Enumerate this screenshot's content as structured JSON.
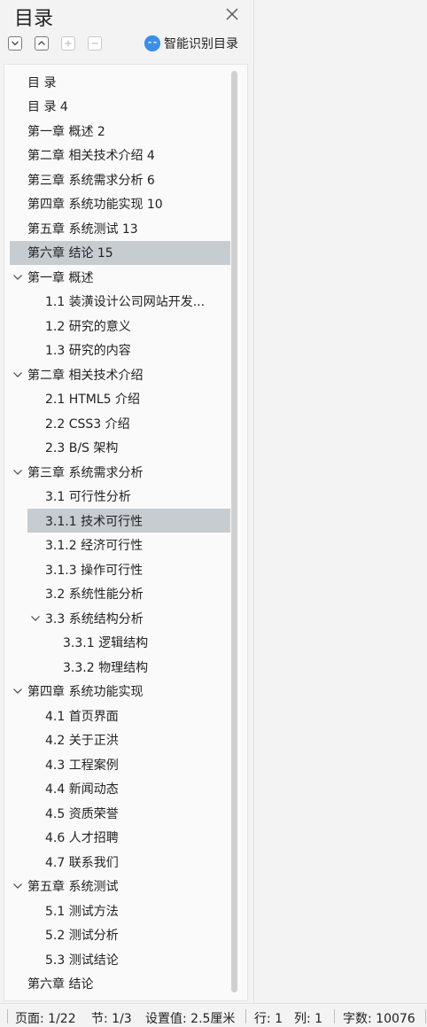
{
  "panel": {
    "title": "目录",
    "smart_label": "智能识别目录"
  },
  "toc": [
    {
      "text": "目  录",
      "level": 0,
      "expanded": null,
      "selected": false
    },
    {
      "text": "目  录 4",
      "level": 0,
      "expanded": null,
      "selected": false
    },
    {
      "text": "第一章   概述  2",
      "level": 0,
      "expanded": null,
      "selected": false
    },
    {
      "text": "第二章   相关技术介绍  4",
      "level": 0,
      "expanded": null,
      "selected": false
    },
    {
      "text": "第三章   系统需求分析  6",
      "level": 0,
      "expanded": null,
      "selected": false
    },
    {
      "text": "第四章   系统功能实现  10",
      "level": 0,
      "expanded": null,
      "selected": false
    },
    {
      "text": "第五章   系统测试  13",
      "level": 0,
      "expanded": null,
      "selected": false
    },
    {
      "text": "第六章   结论  15",
      "level": 0,
      "expanded": null,
      "selected": true
    },
    {
      "text": "第一章   概述",
      "level": 0,
      "expanded": true,
      "selected": false
    },
    {
      "text": "1.1  装潢设计公司网站开发...",
      "level": 1,
      "expanded": null,
      "selected": false
    },
    {
      "text": "1.2    研究的意义",
      "level": 1,
      "expanded": null,
      "selected": false
    },
    {
      "text": "1.3    研究的内容",
      "level": 1,
      "expanded": null,
      "selected": false
    },
    {
      "text": "第二章   相关技术介绍",
      "level": 0,
      "expanded": true,
      "selected": false
    },
    {
      "text": "2.1 HTML5 介绍",
      "level": 1,
      "expanded": null,
      "selected": false
    },
    {
      "text": "2.2    CSS3 介绍",
      "level": 1,
      "expanded": null,
      "selected": false
    },
    {
      "text": "2.3 B/S 架构",
      "level": 1,
      "expanded": null,
      "selected": false
    },
    {
      "text": "第三章   系统需求分析",
      "level": 0,
      "expanded": true,
      "selected": false
    },
    {
      "text": "3.1  可行性分析",
      "level": 1,
      "expanded": null,
      "selected": false
    },
    {
      "text": "3.1.1  技术可行性",
      "level": 1,
      "expanded": null,
      "selected": true
    },
    {
      "text": "3.1.2  经济可行性",
      "level": 1,
      "expanded": null,
      "selected": false
    },
    {
      "text": "3.1.3  操作可行性",
      "level": 1,
      "expanded": null,
      "selected": false
    },
    {
      "text": "3.2  系统性能分析",
      "level": 1,
      "expanded": null,
      "selected": false
    },
    {
      "text": "3.3  系统结构分析",
      "level": 1,
      "expanded": true,
      "selected": false
    },
    {
      "text": "3.3.1 逻辑结构",
      "level": 2,
      "expanded": null,
      "selected": false
    },
    {
      "text": "3.3.2 物理结构",
      "level": 2,
      "expanded": null,
      "selected": false
    },
    {
      "text": "第四章   系统功能实现",
      "level": 0,
      "expanded": true,
      "selected": false
    },
    {
      "text": "4.1  首页界面",
      "level": 1,
      "expanded": null,
      "selected": false
    },
    {
      "text": "4.2  关于正洪",
      "level": 1,
      "expanded": null,
      "selected": false
    },
    {
      "text": "4.3  工程案例",
      "level": 1,
      "expanded": null,
      "selected": false
    },
    {
      "text": "4.4  新闻动态",
      "level": 1,
      "expanded": null,
      "selected": false
    },
    {
      "text": "4.5  资质荣誉",
      "level": 1,
      "expanded": null,
      "selected": false
    },
    {
      "text": "4.6  人才招聘",
      "level": 1,
      "expanded": null,
      "selected": false
    },
    {
      "text": "4.7  联系我们",
      "level": 1,
      "expanded": null,
      "selected": false
    },
    {
      "text": "第五章   系统测试",
      "level": 0,
      "expanded": true,
      "selected": false
    },
    {
      "text": "5.1  测试方法",
      "level": 1,
      "expanded": null,
      "selected": false
    },
    {
      "text": "5.2  测试分析",
      "level": 1,
      "expanded": null,
      "selected": false
    },
    {
      "text": "5.3  测试结论",
      "level": 1,
      "expanded": null,
      "selected": false
    },
    {
      "text": "第六章   结论",
      "level": 0,
      "expanded": null,
      "selected": false
    }
  ],
  "status": {
    "page": "页面: 1/22",
    "section": "节: 1/3",
    "setting": "设置值: 2.5厘米",
    "row": "行: 1",
    "col": "列: 1",
    "words": "字数: 10076"
  },
  "colors": {
    "selection": "#c7ccd1",
    "accent": "#3d8ee8"
  }
}
